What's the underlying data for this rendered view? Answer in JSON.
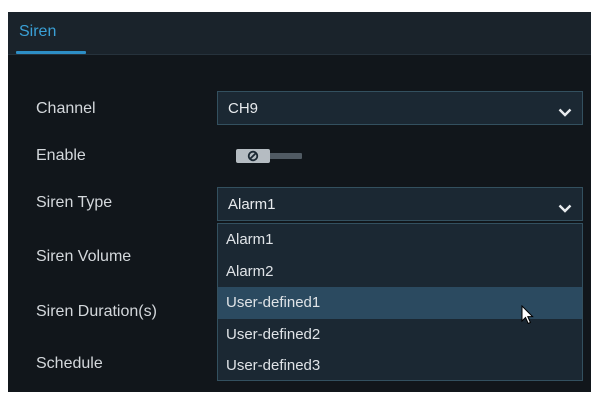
{
  "tabs": [
    {
      "label": "Siren",
      "active": true
    }
  ],
  "form": {
    "channel_label": "Channel",
    "channel_value": "CH9",
    "enable_label": "Enable",
    "enable_state": false,
    "siren_type_label": "Siren Type",
    "siren_type_value": "Alarm1",
    "siren_volume_label": "Siren Volume",
    "siren_duration_label": "Siren Duration(s)",
    "schedule_label": "Schedule"
  },
  "dropdown": {
    "options": [
      "Alarm1",
      "Alarm2",
      "User-defined1",
      "User-defined2",
      "User-defined3"
    ],
    "highlighted": "User-defined1"
  },
  "icons": {
    "select_chevron": "chevron-down-icon",
    "toggle": "power-off-icon",
    "cursor": "mouse-pointer-icon"
  },
  "colors": {
    "panel_bg": "#11161b",
    "accent": "#3aa0d6",
    "field_bg": "#1b2833",
    "field_border": "#33505f",
    "highlight": "#2b4a60"
  }
}
